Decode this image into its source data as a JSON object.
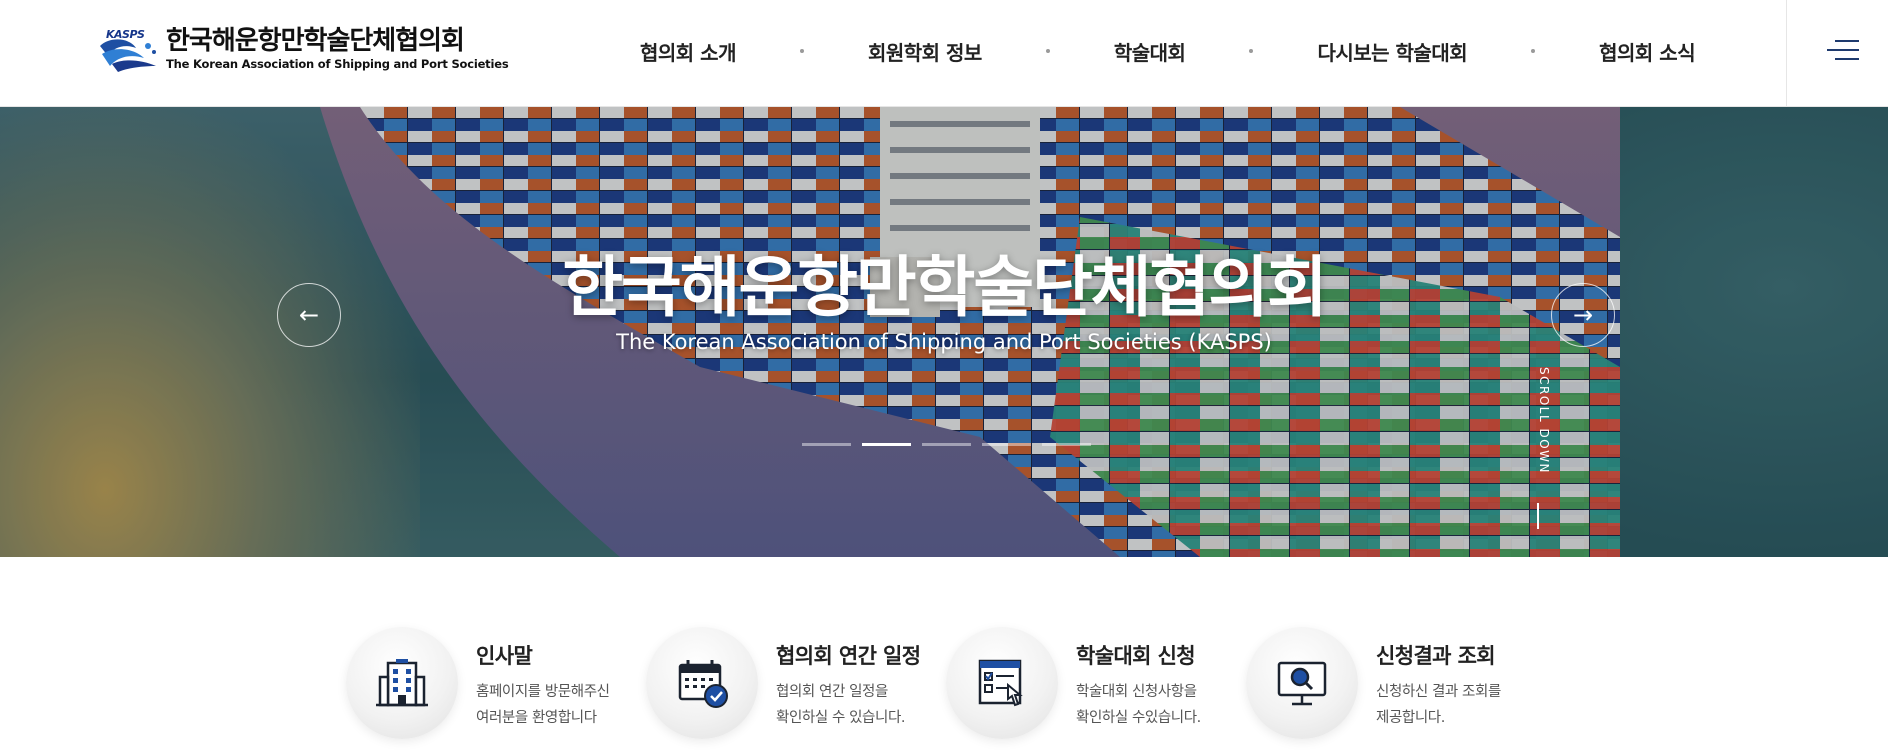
{
  "header": {
    "logo_mark": "KASPS",
    "logo_ko": "한국해운항만학술단체협의회",
    "logo_en": "The Korean Association of Shipping and Port Societies",
    "nav": [
      {
        "label": "협의회 소개"
      },
      {
        "label": "회원학회 정보"
      },
      {
        "label": "학술대회"
      },
      {
        "label": "다시보는 학술대회"
      },
      {
        "label": "협의회 소식"
      }
    ],
    "menu_icon": "hamburger-icon"
  },
  "hero": {
    "title": "한국해운항만학술단체협의회",
    "subtitle": "The Korean Association of Shipping and Port Societies (KASPS)",
    "prev_icon": "arrow-left-icon",
    "next_icon": "arrow-right-icon",
    "prev_glyph": "←",
    "next_glyph": "→",
    "slide_count": 5,
    "active_slide": 2,
    "scroll_label": "SCROLL DOWN"
  },
  "quick_menu": [
    {
      "title": "인사말",
      "desc1": "홈페이지를 방문해주신",
      "desc2": "여러분을 환영합니다",
      "icon": "building-icon"
    },
    {
      "title": "협의회 연간 일정",
      "desc1": "협의회 연간 일정을",
      "desc2": "확인하실 수 있습니다.",
      "icon": "calendar-check-icon"
    },
    {
      "title": "학술대회 신청",
      "desc1": "학술대회 신청사항을",
      "desc2": "확인하실 수있습니다.",
      "icon": "application-form-icon"
    },
    {
      "title": "신청결과 조회",
      "desc1": "신청하신 결과 조회를",
      "desc2": "제공합니다.",
      "icon": "monitor-search-icon"
    }
  ],
  "colors": {
    "brand_navy": "#15358a",
    "icon_blue": "#1e4fa3",
    "text_dark": "#222222"
  }
}
